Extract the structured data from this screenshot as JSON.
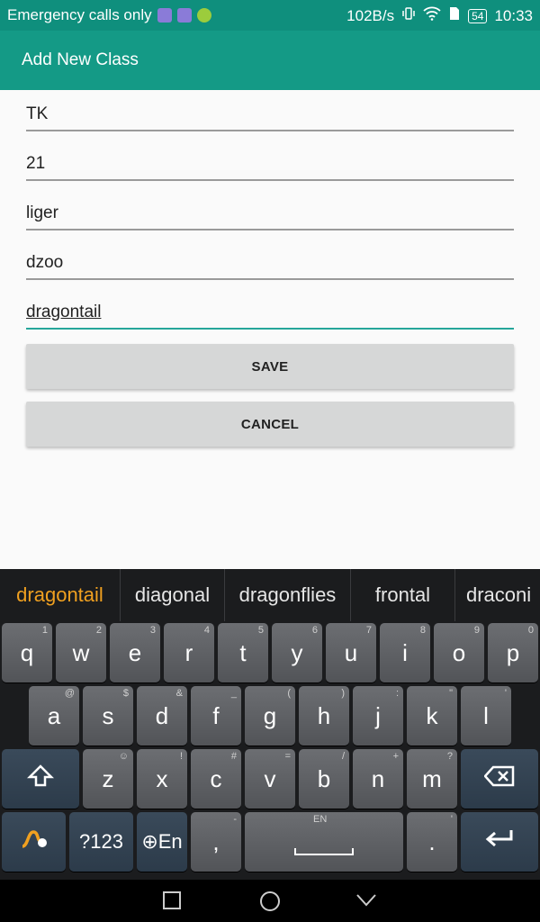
{
  "status": {
    "carrier": "Emergency calls only",
    "net_speed": "102B/s",
    "battery": "54",
    "time": "10:33"
  },
  "app": {
    "title": "Add New Class"
  },
  "form": {
    "fields": [
      "TK",
      "21",
      "liger",
      "dzoo",
      "dragontail"
    ],
    "save_label": "SAVE",
    "cancel_label": "CANCEL"
  },
  "keyboard": {
    "suggestions": [
      "dragontail",
      "diagonal",
      "dragonflies",
      "frontal",
      "draconi"
    ],
    "row1": [
      [
        "q",
        "1"
      ],
      [
        "w",
        "2"
      ],
      [
        "e",
        "3"
      ],
      [
        "r",
        "4"
      ],
      [
        "t",
        "5"
      ],
      [
        "y",
        "6"
      ],
      [
        "u",
        "7"
      ],
      [
        "i",
        "8"
      ],
      [
        "o",
        "9"
      ],
      [
        "p",
        "0"
      ]
    ],
    "row2": [
      [
        "a",
        "@"
      ],
      [
        "s",
        "$"
      ],
      [
        "d",
        "&"
      ],
      [
        "f",
        "_"
      ],
      [
        "g",
        "("
      ],
      [
        "h",
        ")"
      ],
      [
        "j",
        ":"
      ],
      [
        "k",
        "\""
      ],
      [
        "l",
        "'"
      ]
    ],
    "row3": [
      [
        "z",
        "☺"
      ],
      [
        "x",
        "!"
      ],
      [
        "c",
        "#"
      ],
      [
        "v",
        "="
      ],
      [
        "b",
        "/"
      ],
      [
        "n",
        "+"
      ],
      [
        "m",
        "?"
      ]
    ],
    "symbols_label": "?123",
    "lang_label": "⊕En",
    "comma": ",",
    "period": ".",
    "space_hint": "EN",
    "comma_hint": "-",
    "period_hint": "'"
  },
  "icons": {
    "shift": "shift-icon",
    "backspace": "backspace-icon",
    "enter": "enter-icon",
    "swype": "swype-icon"
  },
  "colors": {
    "status_bar": "#0f8f7d",
    "app_bar": "#149a86",
    "accent": "#26a69a",
    "suggestion_highlight": "#f0a020"
  }
}
